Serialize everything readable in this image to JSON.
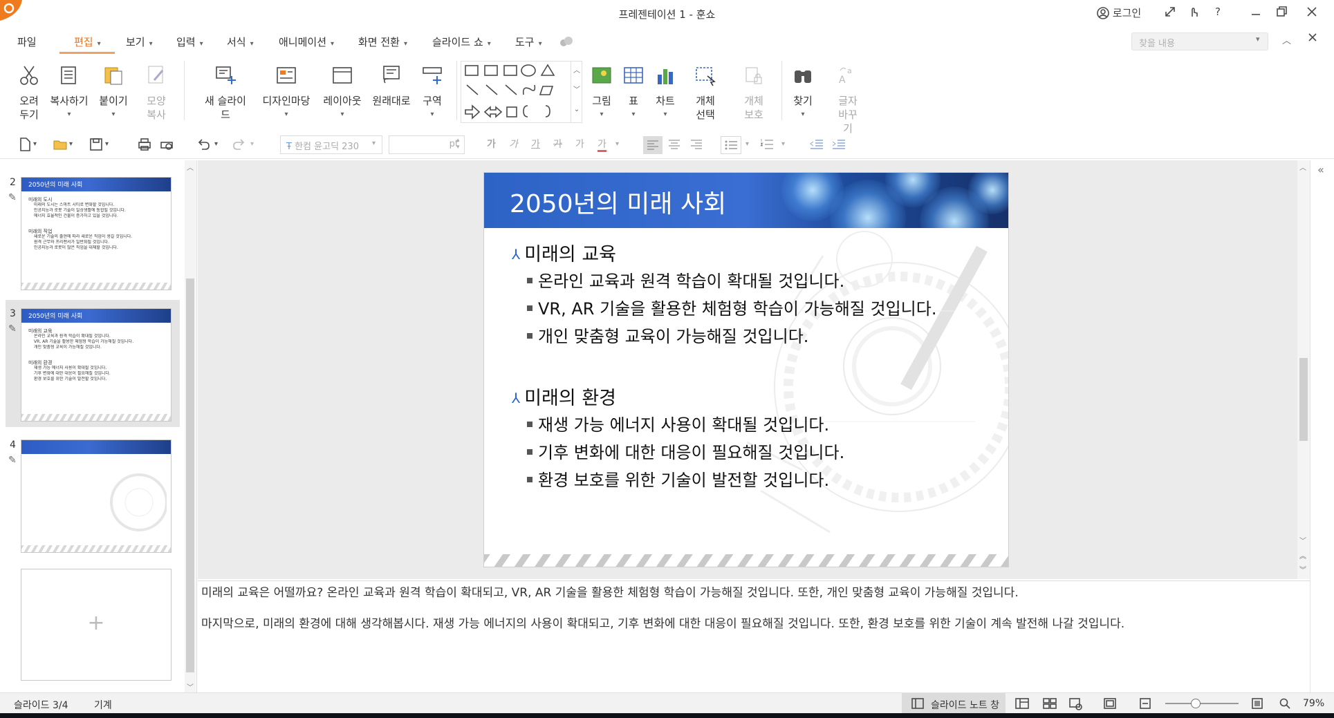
{
  "titlebar": {
    "title": "프레젠테이션 1 - 훈쇼",
    "login": "로그인",
    "help": "?"
  },
  "menu": {
    "file": "파일",
    "edit": "편집",
    "view": "보기",
    "insert": "입력",
    "format": "서식",
    "animation": "애니메이션",
    "transition": "화면 전환",
    "slideshow": "슬라이드 쇼",
    "tools": "도구",
    "search_placeholder": "찾을 내용"
  },
  "ribbon": {
    "cut": "오려 두기",
    "copy": "복사하기",
    "paste": "붙이기",
    "format_copy": "모양 복사",
    "new_slide": "새 슬라이드",
    "design": "디자인마당",
    "layout": "레이아웃",
    "reset": "원래대로",
    "section": "구역",
    "picture": "그림",
    "table": "표",
    "chart": "차트",
    "select_object": "개체 선택",
    "protect_object": "개체 보호",
    "find": "찾기",
    "replace": "글자 바꾸기"
  },
  "toolbar": {
    "font_name": "한컴 윤고딕 230",
    "font_size_unit": "pt",
    "bold": "가",
    "italic": "가",
    "underline": "가",
    "strike": "가",
    "shadow": "가",
    "color": "가"
  },
  "slides": [
    {
      "num": "2",
      "title": "2050년의 미래 사회",
      "sections": [
        {
          "head": "미래의 도시",
          "items": [
            "미래의 도시는 스마트 시티로 변화할 것입니다.",
            "인공지능과 로봇 기술이 일상생활에 통합될 것입니다.",
            "에너지 효율적인 건물이 증가하고 있을 것입니다."
          ]
        },
        {
          "head": "미래의 직업",
          "items": [
            "새로운 기술의 출현에 따라 새로운 직업이 생길 것입니다.",
            "원격 근무와 프리랜서가 일반화될 것입니다.",
            "인공지능과 로봇이 많은 직업을 대체할 것입니다."
          ]
        }
      ]
    },
    {
      "num": "3",
      "title": "2050년의 미래 사회",
      "sections": [
        {
          "head": "미래의 교육",
          "items": [
            "온라인 교육과 원격 학습이 확대될 것입니다.",
            "VR, AR 기술을 활용한 체험형 학습이 가능해질 것입니다.",
            "개인 맞춤형 교육이 가능해질 것입니다."
          ]
        },
        {
          "head": "미래의 환경",
          "items": [
            "재생 가능 에너지 사용이 확대될 것입니다.",
            "기후 변화에 대한 대응이 필요해질 것입니다.",
            "환경 보호를 위한 기술이 발전할 것입니다."
          ]
        }
      ]
    },
    {
      "num": "4"
    }
  ],
  "current_slide": {
    "title": "2050년의 미래 사회",
    "section1": {
      "head": "미래의 교육",
      "items": [
        "온라인 교육과 원격 학습이 확대될 것입니다.",
        "VR, AR 기술을 활용한 체험형 학습이 가능해질 것입니다.",
        "개인 맞춤형 교육이 가능해질 것입니다."
      ]
    },
    "section2": {
      "head": "미래의 환경",
      "items": [
        "재생 가능 에너지 사용이 확대될 것입니다.",
        "기후 변화에 대한 대응이 필요해질 것입니다.",
        "환경 보호를 위한 기술이 발전할 것입니다."
      ]
    }
  },
  "notes": [
    "미래의 교육은 어떨까요? 온라인 교육과 원격 학습이 확대되고, VR, AR 기술을 활용한 체험형 학습이 가능해질 것입니다. 또한, 개인 맞춤형 교육이 가능해질 것입니다.",
    "마지막으로, 미래의 환경에 대해 생각해봅시다. 재생 가능 에너지의 사용이 확대되고, 기후 변화에 대한 대응이 필요해질 것입니다. 또한, 환경 보호를 위한 기술이 계속 발전해 나갈 것입니다."
  ],
  "status": {
    "slide_pos": "슬라이드 3/4",
    "theme": "기계",
    "view_label": "슬라이드 노트 창",
    "zoom": "79%"
  },
  "colors": {
    "accent": "#e8731a",
    "slide_header": "#2e63c6"
  }
}
